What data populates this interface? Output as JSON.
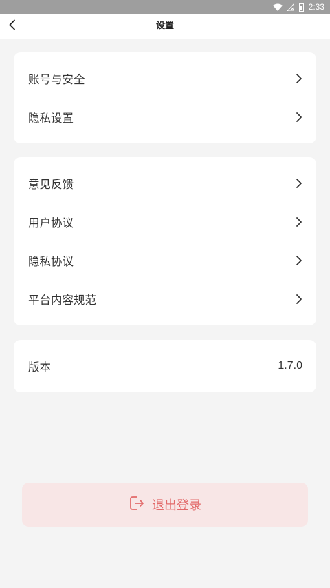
{
  "status_bar": {
    "time": "2:33",
    "icons": [
      "wifi-icon",
      "no-signal-icon",
      "battery-icon"
    ]
  },
  "header": {
    "title": "设置",
    "back_icon": "chevron-left-icon"
  },
  "settings_group_1": {
    "items": [
      {
        "label": "账号与安全"
      },
      {
        "label": "隐私设置"
      }
    ]
  },
  "settings_group_2": {
    "items": [
      {
        "label": "意见反馈"
      },
      {
        "label": "用户协议"
      },
      {
        "label": "隐私协议"
      },
      {
        "label": "平台内容规范"
      }
    ]
  },
  "version": {
    "label": "版本",
    "value": "1.7.0"
  },
  "logout": {
    "label": "退出登录",
    "icon": "logout-icon"
  },
  "colors": {
    "page_background": "#f4f4f4",
    "card_background": "#ffffff",
    "status_bar": "#9e9e9e",
    "logout_background": "#f8e6e6",
    "logout_text": "#e26a6a",
    "primary_text": "#333333"
  }
}
